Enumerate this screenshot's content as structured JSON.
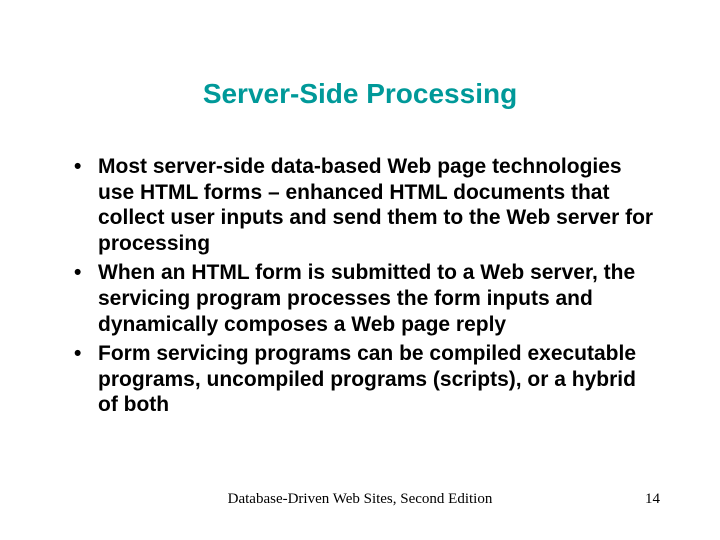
{
  "title": "Server-Side Processing",
  "bullets": [
    "Most server-side data-based Web page technologies use HTML forms – enhanced HTML documents that collect user inputs and send them to the Web server for processing",
    "When an HTML form is submitted to a Web server, the servicing program processes the form inputs and dynamically composes a Web page reply",
    "Form servicing programs can be compiled executable programs, uncompiled programs (scripts), or a hybrid of both"
  ],
  "footer": {
    "text": "Database-Driven Web Sites, Second Edition",
    "page": "14"
  }
}
